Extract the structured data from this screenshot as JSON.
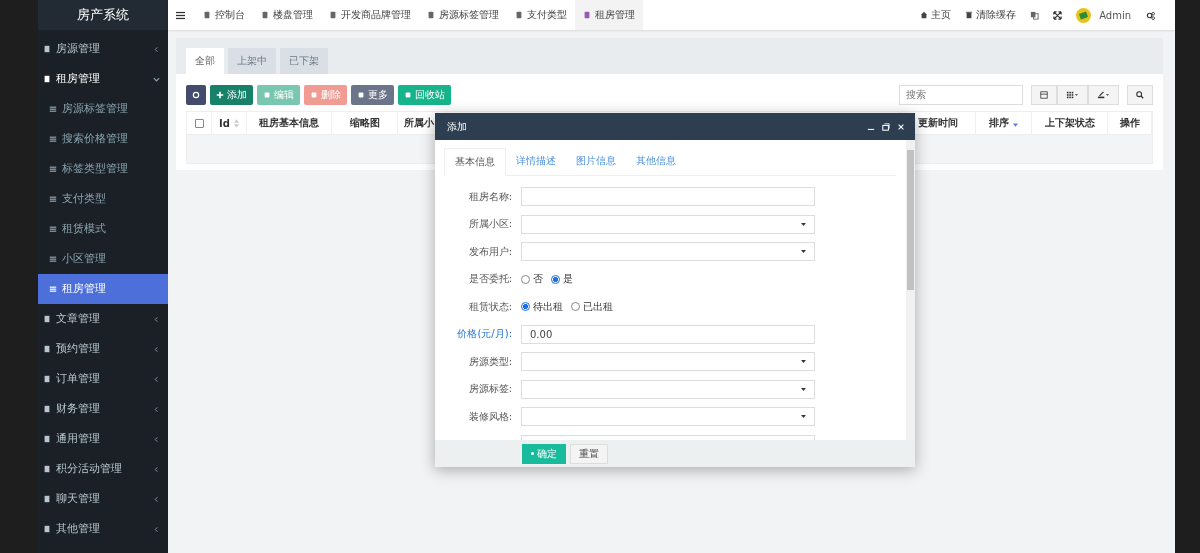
{
  "sidebar": {
    "title": "房产系统",
    "items": [
      {
        "label": "房源管理",
        "expanded": false,
        "selected": false
      },
      {
        "label": "租房管理",
        "expanded": true,
        "selected": false,
        "children": [
          {
            "label": "房源标签管理",
            "selected": false
          },
          {
            "label": "搜索价格管理",
            "selected": false
          },
          {
            "label": "标签类型管理",
            "selected": false
          },
          {
            "label": "支付类型",
            "selected": false
          },
          {
            "label": "租赁模式",
            "selected": false
          },
          {
            "label": "小区管理",
            "selected": false
          },
          {
            "label": "租房管理",
            "selected": true
          }
        ]
      },
      {
        "label": "文章管理",
        "expanded": false,
        "selected": false
      },
      {
        "label": "预约管理",
        "expanded": false,
        "selected": false
      },
      {
        "label": "订单管理",
        "expanded": false,
        "selected": false
      },
      {
        "label": "财务管理",
        "expanded": false,
        "selected": false
      },
      {
        "label": "通用管理",
        "expanded": false,
        "selected": false
      },
      {
        "label": "积分活动管理",
        "expanded": false,
        "selected": false
      },
      {
        "label": "聊天管理",
        "expanded": false,
        "selected": false
      },
      {
        "label": "其他管理",
        "expanded": false,
        "selected": false
      }
    ]
  },
  "top_nav": {
    "tabs": [
      {
        "label": "控制台",
        "selected": false
      },
      {
        "label": "楼盘管理",
        "selected": false
      },
      {
        "label": "开发商品牌管理",
        "selected": false
      },
      {
        "label": "房源标签管理",
        "selected": false
      },
      {
        "label": "支付类型",
        "selected": false
      },
      {
        "label": "租房管理",
        "selected": true
      }
    ],
    "links": [
      {
        "label": "主页"
      },
      {
        "label": "清除缓存"
      }
    ],
    "user": {
      "name": "Admin"
    }
  },
  "filter_tabs": [
    {
      "label": "全部",
      "selected": true
    },
    {
      "label": "上架中",
      "selected": false
    },
    {
      "label": "已下架",
      "selected": false
    }
  ],
  "toolbar": {
    "buttons": [
      {
        "kind": "refresh",
        "disabled": false
      },
      {
        "kind": "add",
        "label": "添加",
        "disabled": false
      },
      {
        "kind": "edit",
        "label": "编辑",
        "disabled": true
      },
      {
        "kind": "delete",
        "label": "删除",
        "disabled": true
      },
      {
        "kind": "more",
        "label": "更多",
        "disabled": false
      },
      {
        "kind": "recycle",
        "label": "回收站",
        "disabled": false
      }
    ],
    "search": {
      "placeholder": "搜索"
    }
  },
  "table": {
    "select_all": {
      "checked": false
    },
    "columns": [
      {
        "label": "Id",
        "kind": "sortable"
      },
      {
        "label": "租房基本信息",
        "kind": "plain"
      },
      {
        "label": "缩略图",
        "kind": "plain"
      },
      {
        "label": "所属小",
        "kind": "cut"
      },
      {
        "label": "更新时间",
        "kind": "plain"
      },
      {
        "label": "排序",
        "kind": "sorted"
      },
      {
        "label": "上下架状态",
        "kind": "plain"
      },
      {
        "label": "操作",
        "kind": "plain"
      }
    ]
  },
  "dialog": {
    "title": "添加",
    "tabs": [
      {
        "label": "基本信息",
        "selected": true
      },
      {
        "label": "详情描述",
        "selected": false
      },
      {
        "label": "图片信息",
        "selected": false
      },
      {
        "label": "其他信息",
        "selected": false
      }
    ],
    "fields": [
      {
        "kind": "text",
        "label": "租房名称:",
        "emphasized": false
      },
      {
        "kind": "select",
        "label": "所属小区:",
        "emphasized": false
      },
      {
        "kind": "select",
        "label": "发布用户:",
        "emphasized": false
      },
      {
        "kind": "radio",
        "label": "是否委托:",
        "emphasized": false,
        "options": [
          {
            "label": "否",
            "selected": false
          },
          {
            "label": "是",
            "selected": true
          }
        ]
      },
      {
        "kind": "radio",
        "label": "租赁状态:",
        "emphasized": false,
        "options": [
          {
            "label": "待出租",
            "selected": true
          },
          {
            "label": "已出租",
            "selected": false
          }
        ]
      },
      {
        "kind": "text",
        "label": "价格(元/月):",
        "emphasized": true,
        "value": "0.00"
      },
      {
        "kind": "select",
        "label": "房源类型:",
        "emphasized": false
      },
      {
        "kind": "select",
        "label": "房源标签:",
        "emphasized": false
      },
      {
        "kind": "select",
        "label": "装修风格:",
        "emphasized": false
      },
      {
        "kind": "text"
      }
    ],
    "buttons": [
      {
        "kind": "primary",
        "label": "确定"
      },
      {
        "kind": "default",
        "label": "重置"
      }
    ]
  }
}
